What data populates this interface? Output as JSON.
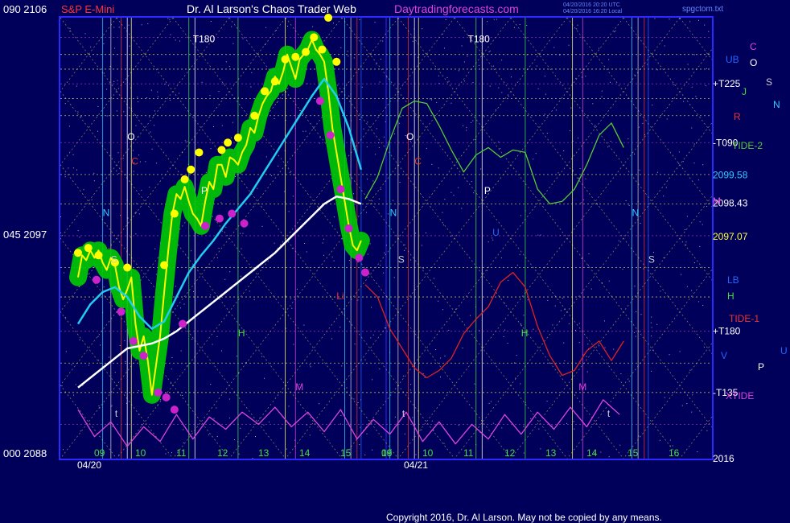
{
  "header": {
    "left_values": "090  2106",
    "instrument": "S&P E-Mini",
    "site_title": "Dr. Al Larson's Chaos Trader Web",
    "site_url": "Daytradingforecasts.com",
    "stamp_line1": "04/20/2016 20:20 UTC",
    "stamp_line2": "04/20/2016 16:20 Local",
    "filename": "spgctom.txt"
  },
  "footer": {
    "copyright": "Copyright 2016, Dr. Al Larson. May not be copied by any means."
  },
  "colors": {
    "background": "#00005a",
    "frame": "#2a2aff",
    "price": "#ffff00",
    "channel": "#00cc00",
    "dots": "#ffff00",
    "pink_dots": "#cc22cc",
    "avg_fast": "#22ccee",
    "avg_slow": "#ffffff",
    "tide1": "#dd2222",
    "tide2": "#55cc33",
    "xtide": "#dd44dd",
    "grid": "#ffff66"
  },
  "chart_data": {
    "type": "line",
    "title": "S&P E-Mini",
    "y_axis_left": [
      {
        "angle": "090",
        "price": "2106"
      },
      {
        "angle": "045",
        "price": "2097"
      },
      {
        "angle": "000",
        "price": "2088"
      }
    ],
    "ylim": [
      2088,
      2106
    ],
    "x_axis": {
      "day1_label": "04/20",
      "day2_label": "04/21",
      "day1_hours": [
        "09",
        "10",
        "11",
        "12",
        "13",
        "14",
        "15",
        "16"
      ],
      "day2_hours": [
        "09",
        "10",
        "11",
        "12",
        "13",
        "14",
        "15",
        "16"
      ]
    },
    "right_levels": [
      {
        "label": "+T225",
        "value": 2103.3,
        "color": "#ffffff"
      },
      {
        "label": "-T090",
        "value": 2100.9,
        "color": "#ffffff"
      },
      {
        "label": "2099.58",
        "value": 2099.58,
        "color": "#33ccff"
      },
      {
        "label": "2098.43",
        "value": 2098.43,
        "color": "#ffffff"
      },
      {
        "label": "2097.07",
        "value": 2097.07,
        "color": "#ffff44"
      },
      {
        "label": "+T180",
        "value": 2093.2,
        "color": "#ffffff"
      },
      {
        "label": "-T135",
        "value": 2090.7,
        "color": "#ffffff"
      },
      {
        "label": "2016",
        "value": 2088.0,
        "color": "#ffffff"
      }
    ],
    "right_tags": [
      {
        "label": "C",
        "color": "#dd44dd"
      },
      {
        "label": "O",
        "color": "#ffffff"
      },
      {
        "label": "UB",
        "color": "#2266ff"
      },
      {
        "label": "S",
        "color": "#cccccc"
      },
      {
        "label": "N",
        "color": "#33ccff"
      },
      {
        "label": "J",
        "color": "#44dd44"
      },
      {
        "label": "R",
        "color": "#ee3333"
      },
      {
        "label": "TIDE-2",
        "color": "#55cc33"
      },
      {
        "label": "M",
        "color": "#dd44dd"
      },
      {
        "label": "LB",
        "color": "#2266ff"
      },
      {
        "label": "H",
        "color": "#44dd44"
      },
      {
        "label": "TIDE-1",
        "color": "#ee3333"
      },
      {
        "label": "V",
        "color": "#2266ff"
      },
      {
        "label": "U",
        "color": "#2266ff"
      },
      {
        "label": "P",
        "color": "#ffffff"
      },
      {
        "label": "XTIDE",
        "color": "#dd44dd"
      }
    ],
    "in_chart_labels": [
      {
        "label": "T180",
        "color": "#ffffff",
        "day": 1,
        "hour": 11.8,
        "price": 2105.0
      },
      {
        "label": "T180",
        "color": "#ffffff",
        "day": 2,
        "hour": 11.5,
        "price": 2105.0
      },
      {
        "label": "O",
        "color": "#ffffff",
        "day": 1,
        "hour": 10.2,
        "price": 2101.0
      },
      {
        "label": "O",
        "color": "#ffffff",
        "day": 2,
        "hour": 10.0,
        "price": 2101.0
      },
      {
        "label": "C",
        "color": "#dd3333",
        "day": 1,
        "hour": 10.3,
        "price": 2100.0
      },
      {
        "label": "C",
        "color": "#dd3333",
        "day": 2,
        "hour": 10.2,
        "price": 2100.0
      },
      {
        "label": "P",
        "color": "#ffffff",
        "day": 1,
        "hour": 12.0,
        "price": 2098.8
      },
      {
        "label": "P",
        "color": "#ffffff",
        "day": 2,
        "hour": 11.9,
        "price": 2098.8
      },
      {
        "label": "N",
        "color": "#33ccff",
        "day": 1,
        "hour": 9.6,
        "price": 2097.9
      },
      {
        "label": "N",
        "color": "#33ccff",
        "day": 2,
        "hour": 9.6,
        "price": 2097.9
      },
      {
        "label": "N",
        "color": "#33ccff",
        "day": 2,
        "hour": 15.5,
        "price": 2097.9
      },
      {
        "label": "S",
        "color": "#cccccc",
        "day": 1,
        "hour": 9.8,
        "price": 2096.0
      },
      {
        "label": "S",
        "color": "#cccccc",
        "day": 2,
        "hour": 9.8,
        "price": 2096.0
      },
      {
        "label": "S",
        "color": "#cccccc",
        "day": 2,
        "hour": 15.9,
        "price": 2096.0
      },
      {
        "label": "U",
        "color": "#2266ff",
        "day": 2,
        "hour": 12.1,
        "price": 2097.1
      },
      {
        "label": "H",
        "color": "#44dd44",
        "day": 1,
        "hour": 12.9,
        "price": 2093.0
      },
      {
        "label": "H",
        "color": "#44dd44",
        "day": 2,
        "hour": 12.8,
        "price": 2093.0
      },
      {
        "label": "M",
        "color": "#dd44dd",
        "day": 1,
        "hour": 14.3,
        "price": 2090.8
      },
      {
        "label": "M",
        "color": "#dd44dd",
        "day": 2,
        "hour": 14.2,
        "price": 2090.8
      },
      {
        "label": "t",
        "color": "#cccccc",
        "day": 1,
        "hour": 9.9,
        "price": 2089.7
      },
      {
        "label": "t",
        "color": "#cccccc",
        "day": 2,
        "hour": 9.9,
        "price": 2089.7
      },
      {
        "label": "t",
        "color": "#cccccc",
        "day": 2,
        "hour": 14.9,
        "price": 2089.7
      },
      {
        "label": "Li",
        "color": "#ee3333",
        "day": 1,
        "hour": 15.3,
        "price": 2094.5
      }
    ],
    "series": [
      {
        "name": "Price",
        "color": "#ffff00",
        "x_hours": [
          9.0,
          9.1,
          9.2,
          9.3,
          9.4,
          9.5,
          9.6,
          9.7,
          9.8,
          9.9,
          10.0,
          10.1,
          10.2,
          10.3,
          10.4,
          10.5,
          10.6,
          10.7,
          10.8,
          10.9,
          11.0,
          11.1,
          11.2,
          11.3,
          11.4,
          11.5,
          11.6,
          11.7,
          11.8,
          11.9,
          12.0,
          12.1,
          12.2,
          12.3,
          12.4,
          12.5,
          12.6,
          12.7,
          12.8,
          12.9,
          13.0,
          13.1,
          13.2,
          13.3,
          13.4,
          13.5,
          13.6,
          13.7,
          13.8,
          13.9,
          14.0,
          14.1,
          14.2,
          14.3,
          14.4,
          14.5,
          14.6,
          14.7,
          14.8,
          14.9,
          15.0,
          15.1,
          15.2,
          15.3,
          15.4,
          15.5,
          15.6,
          15.7,
          15.8,
          15.9
        ],
        "values": [
          2095.4,
          2096.3,
          2096.1,
          2096.5,
          2096.2,
          2096.5,
          2096.0,
          2095.7,
          2096.2,
          2095.9,
          2095.0,
          2094.5,
          2094.9,
          2095.4,
          2093.5,
          2092.4,
          2093.0,
          2092.0,
          2090.6,
          2091.8,
          2093.0,
          2094.8,
          2096.5,
          2098.0,
          2098.8,
          2098.6,
          2099.1,
          2098.5,
          2098.0,
          2097.8,
          2097.5,
          2098.5,
          2099.3,
          2099.0,
          2100.0,
          2100.0,
          2099.5,
          2100.3,
          2100.2,
          2100.0,
          2100.5,
          2100.8,
          2101.5,
          2101.3,
          2102.0,
          2102.5,
          2102.8,
          2103.0,
          2103.6,
          2103.3,
          2103.8,
          2104.5,
          2104.0,
          2103.5,
          2104.3,
          2104.5,
          2104.7,
          2105.1,
          2104.7,
          2104.5,
          2104.2,
          2103.0,
          2101.5,
          2100.5,
          2099.5,
          2098.5,
          2097.5,
          2096.7,
          2096.5,
          2096.9
        ]
      },
      {
        "name": "Fast average",
        "color": "#22ccee",
        "x_hours": [
          9.0,
          9.3,
          9.6,
          9.9,
          10.2,
          10.5,
          10.8,
          11.1,
          11.4,
          11.7,
          12.0,
          12.3,
          12.6,
          12.9,
          13.2,
          13.5,
          13.8,
          14.1,
          14.4,
          14.7,
          15.0,
          15.3,
          15.6,
          15.9
        ],
        "values": [
          2093.5,
          2094.3,
          2094.8,
          2095.0,
          2094.6,
          2093.8,
          2093.3,
          2093.6,
          2094.6,
          2095.6,
          2096.3,
          2096.9,
          2097.6,
          2098.2,
          2098.8,
          2099.6,
          2100.4,
          2101.2,
          2102.0,
          2102.8,
          2103.5,
          2102.8,
          2101.5,
          2099.8
        ]
      },
      {
        "name": "Slow average",
        "color": "#ffffff",
        "x_hours": [
          9.0,
          9.3,
          9.6,
          9.9,
          10.2,
          10.5,
          10.8,
          11.1,
          11.4,
          11.7,
          12.0,
          12.3,
          12.6,
          12.9,
          13.2,
          13.5,
          13.8,
          14.1,
          14.4,
          14.7,
          15.0,
          15.3,
          15.6,
          15.9
        ],
        "values": [
          2090.9,
          2091.3,
          2091.7,
          2092.1,
          2092.5,
          2092.6,
          2092.7,
          2092.9,
          2093.2,
          2093.6,
          2094.0,
          2094.4,
          2094.8,
          2095.2,
          2095.6,
          2096.0,
          2096.4,
          2096.9,
          2097.4,
          2097.9,
          2098.4,
          2098.7,
          2098.6,
          2098.4
        ]
      },
      {
        "name": "TIDE-2",
        "color": "#55cc33",
        "x_hours": [
          16.0,
          16.3,
          16.6,
          16.9,
          17.2,
          17.5,
          17.8,
          18.1,
          18.4,
          18.7,
          19.0,
          19.3,
          19.6,
          19.9,
          20.2,
          20.5,
          20.8,
          21.1,
          21.4,
          21.7,
          22.0,
          22.3
        ],
        "values": [
          2098.6,
          2099.5,
          2101.0,
          2102.3,
          2102.6,
          2102.5,
          2101.6,
          2100.6,
          2099.7,
          2100.4,
          2100.7,
          2100.3,
          2100.6,
          2100.5,
          2099.0,
          2098.4,
          2098.5,
          2099.0,
          2100.0,
          2101.2,
          2101.7,
          2100.7
        ]
      },
      {
        "name": "TIDE-1",
        "color": "#dd2222",
        "x_hours": [
          16.0,
          16.3,
          16.6,
          16.9,
          17.2,
          17.5,
          17.8,
          18.1,
          18.4,
          18.7,
          19.0,
          19.3,
          19.6,
          19.9,
          20.2,
          20.5,
          20.8,
          21.1,
          21.4,
          21.7,
          22.0,
          22.3
        ],
        "values": [
          2095.1,
          2094.6,
          2093.3,
          2092.5,
          2091.7,
          2091.3,
          2091.6,
          2092.1,
          2093.1,
          2093.7,
          2094.2,
          2095.2,
          2095.6,
          2095.0,
          2093.4,
          2092.2,
          2091.4,
          2091.6,
          2092.4,
          2092.8,
          2092.0,
          2092.8
        ]
      },
      {
        "name": "XTIDE",
        "color": "#dd44dd",
        "x_hours": [
          9.0,
          9.4,
          9.8,
          10.2,
          10.6,
          11.0,
          11.4,
          11.8,
          12.2,
          12.6,
          13.0,
          13.4,
          13.8,
          14.2,
          14.6,
          15.0,
          15.4,
          15.8,
          16.2,
          16.6,
          17.0,
          17.4,
          17.8,
          18.2,
          18.6,
          19.0,
          19.4,
          19.8,
          20.2,
          20.6,
          21.0,
          21.4,
          21.8,
          22.2
        ],
        "values": [
          2090.0,
          2088.9,
          2089.5,
          2088.5,
          2089.3,
          2088.7,
          2089.8,
          2088.8,
          2089.7,
          2089.2,
          2089.9,
          2089.4,
          2090.1,
          2089.3,
          2089.9,
          2089.1,
          2090.0,
          2088.8,
          2089.6,
          2089.0,
          2089.9,
          2088.7,
          2089.5,
          2088.6,
          2089.4,
          2088.8,
          2089.8,
          2089.0,
          2089.9,
          2089.2,
          2090.1,
          2089.3,
          2090.4,
          2089.8
        ]
      }
    ],
    "yellow_dots": [
      [
        9.0,
        2096.4
      ],
      [
        9.25,
        2096.6
      ],
      [
        9.5,
        2096.3
      ],
      [
        9.9,
        2096.0
      ],
      [
        10.2,
        2095.8
      ],
      [
        11.1,
        2095.9
      ],
      [
        11.35,
        2098.0
      ],
      [
        11.6,
        2099.4
      ],
      [
        11.75,
        2099.8
      ],
      [
        11.95,
        2100.5
      ],
      [
        12.5,
        2100.6
      ],
      [
        12.65,
        2100.9
      ],
      [
        12.9,
        2101.1
      ],
      [
        13.3,
        2102.0
      ],
      [
        13.55,
        2103.0
      ],
      [
        13.8,
        2103.4
      ],
      [
        14.05,
        2104.3
      ],
      [
        14.3,
        2104.4
      ],
      [
        14.55,
        2104.6
      ],
      [
        14.75,
        2105.2
      ],
      [
        14.95,
        2104.7
      ],
      [
        15.1,
        2106.0
      ],
      [
        15.3,
        2104.2
      ]
    ],
    "pink_dots": [
      [
        9.45,
        2095.3
      ],
      [
        10.05,
        2094.0
      ],
      [
        10.35,
        2092.8
      ],
      [
        10.6,
        2092.2
      ],
      [
        10.95,
        2090.7
      ],
      [
        11.15,
        2090.5
      ],
      [
        11.35,
        2090.0
      ],
      [
        11.55,
        2093.5
      ],
      [
        12.1,
        2097.5
      ],
      [
        12.45,
        2097.8
      ],
      [
        12.75,
        2098.0
      ],
      [
        13.05,
        2097.6
      ],
      [
        14.9,
        2102.6
      ],
      [
        15.15,
        2101.2
      ],
      [
        15.4,
        2099.0
      ],
      [
        15.6,
        2097.4
      ],
      [
        15.85,
        2096.2
      ],
      [
        16.0,
        2095.6
      ]
    ]
  }
}
